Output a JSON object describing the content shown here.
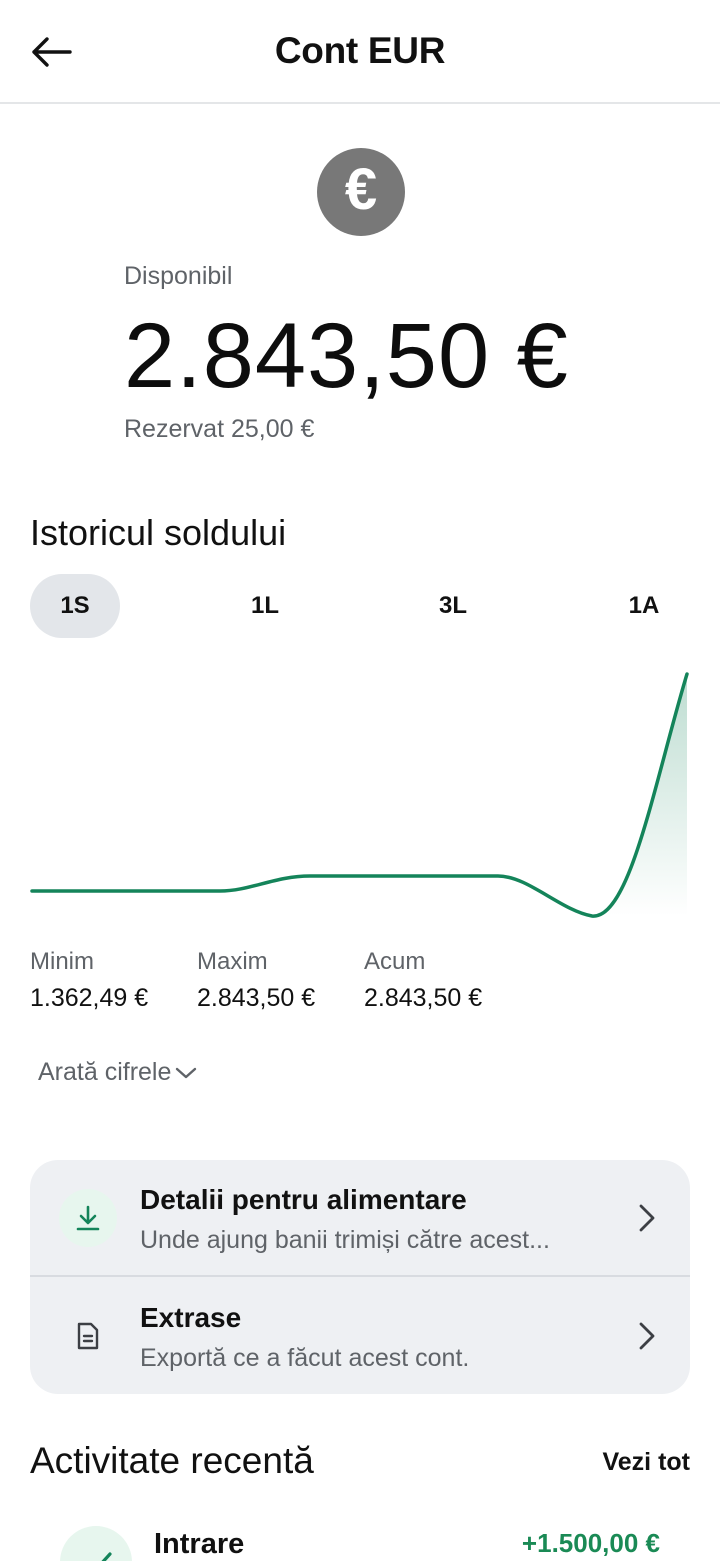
{
  "header": {
    "title": "Cont EUR",
    "back_icon": "arrow-left-icon"
  },
  "account": {
    "currency_symbol": "€",
    "available_label": "Disponibil",
    "balance": "2.843,50 €",
    "reserved": "Rezervat 25,00 €"
  },
  "history": {
    "title": "Istoricul soldului",
    "tabs": [
      {
        "label": "1S",
        "active": true
      },
      {
        "label": "1L",
        "active": false
      },
      {
        "label": "3L",
        "active": false
      },
      {
        "label": "1A",
        "active": false
      }
    ],
    "line_color": "#14845a",
    "stats": [
      {
        "label": "Minim",
        "value": "1.362,49 €"
      },
      {
        "label": "Maxim",
        "value": "2.843,50 €"
      },
      {
        "label": "Acum",
        "value": "2.843,50 €"
      }
    ],
    "show_figures": "Arată cifrele"
  },
  "actions": [
    {
      "title": "Detalii pentru alimentare",
      "subtitle": "Unde ajung banii trimiși către acest...",
      "icon": "download-icon"
    },
    {
      "title": "Extrase",
      "subtitle": "Exportă ce a făcut acest cont.",
      "icon": "document-icon"
    }
  ],
  "recent": {
    "title": "Activitate recentă",
    "see_all": "Vezi tot",
    "transactions": [
      {
        "title": "Intrare",
        "amount": "+1.500,00 €",
        "icon": "check-icon"
      }
    ]
  },
  "colors": {
    "accent_green": "#1a8a55",
    "badge_gray": "#787878",
    "card_bg": "#eef0f3"
  }
}
